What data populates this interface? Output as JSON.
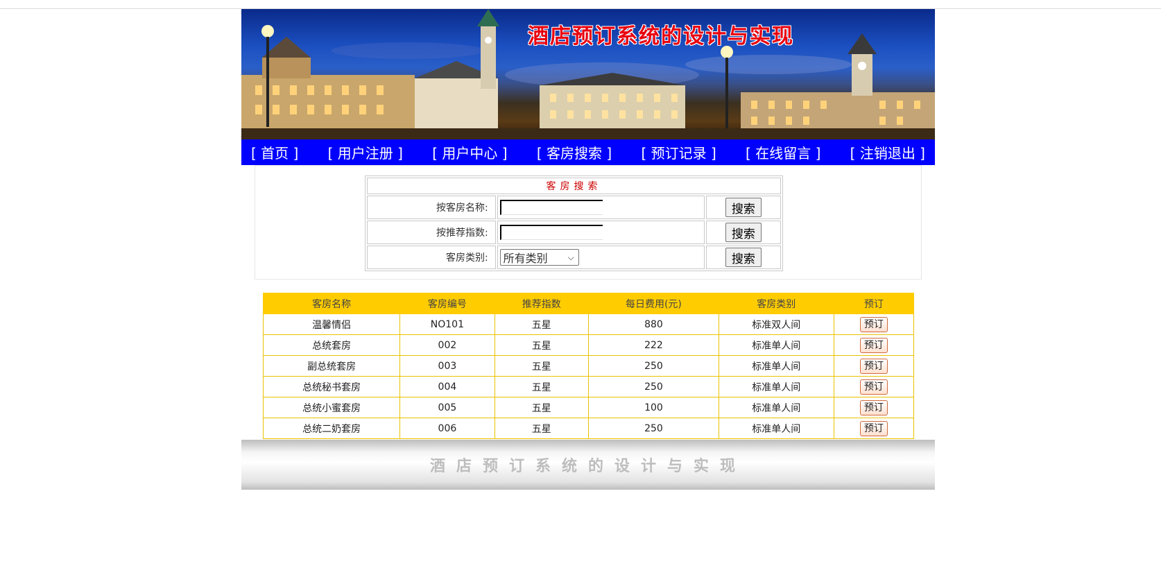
{
  "banner": {
    "title": "酒店预订系统的设计与实现"
  },
  "nav": [
    "[ 首页 ]",
    "[ 用户注册 ]",
    "[ 用户中心 ]",
    "[ 客房搜索 ]",
    "[ 预订记录 ]",
    "[ 在线留言 ]",
    "[ 注销退出 ]"
  ],
  "search": {
    "title": "客房搜索",
    "by_name_label": "按客房名称:",
    "by_name_value": "",
    "by_rating_label": "按推荐指数:",
    "by_rating_value": "",
    "category_label": "客房类别:",
    "category_selected": "所有类别",
    "button_label": "搜索"
  },
  "rooms": {
    "headers": [
      "客房名称",
      "客房编号",
      "推荐指数",
      "每日费用(元)",
      "客房类别",
      "预订"
    ],
    "book_label": "预订",
    "rows": [
      [
        "温馨情侣",
        "NO101",
        "五星",
        "880",
        "标准双人间"
      ],
      [
        "总统套房",
        "002",
        "五星",
        "222",
        "标准单人间"
      ],
      [
        "副总统套房",
        "003",
        "五星",
        "250",
        "标准单人间"
      ],
      [
        "总统秘书套房",
        "004",
        "五星",
        "250",
        "标准单人间"
      ],
      [
        "总统小蜜套房",
        "005",
        "五星",
        "100",
        "标准单人间"
      ],
      [
        "总统二奶套房",
        "006",
        "五星",
        "250",
        "标准单人间"
      ]
    ]
  },
  "footer": {
    "text": "酒店预订系统的设计与实现"
  },
  "colors": {
    "nav_bg": "#0000ff",
    "table_header_bg": "#ffcc00",
    "search_title": "#cc0000",
    "banner_title": "#e8000e"
  }
}
